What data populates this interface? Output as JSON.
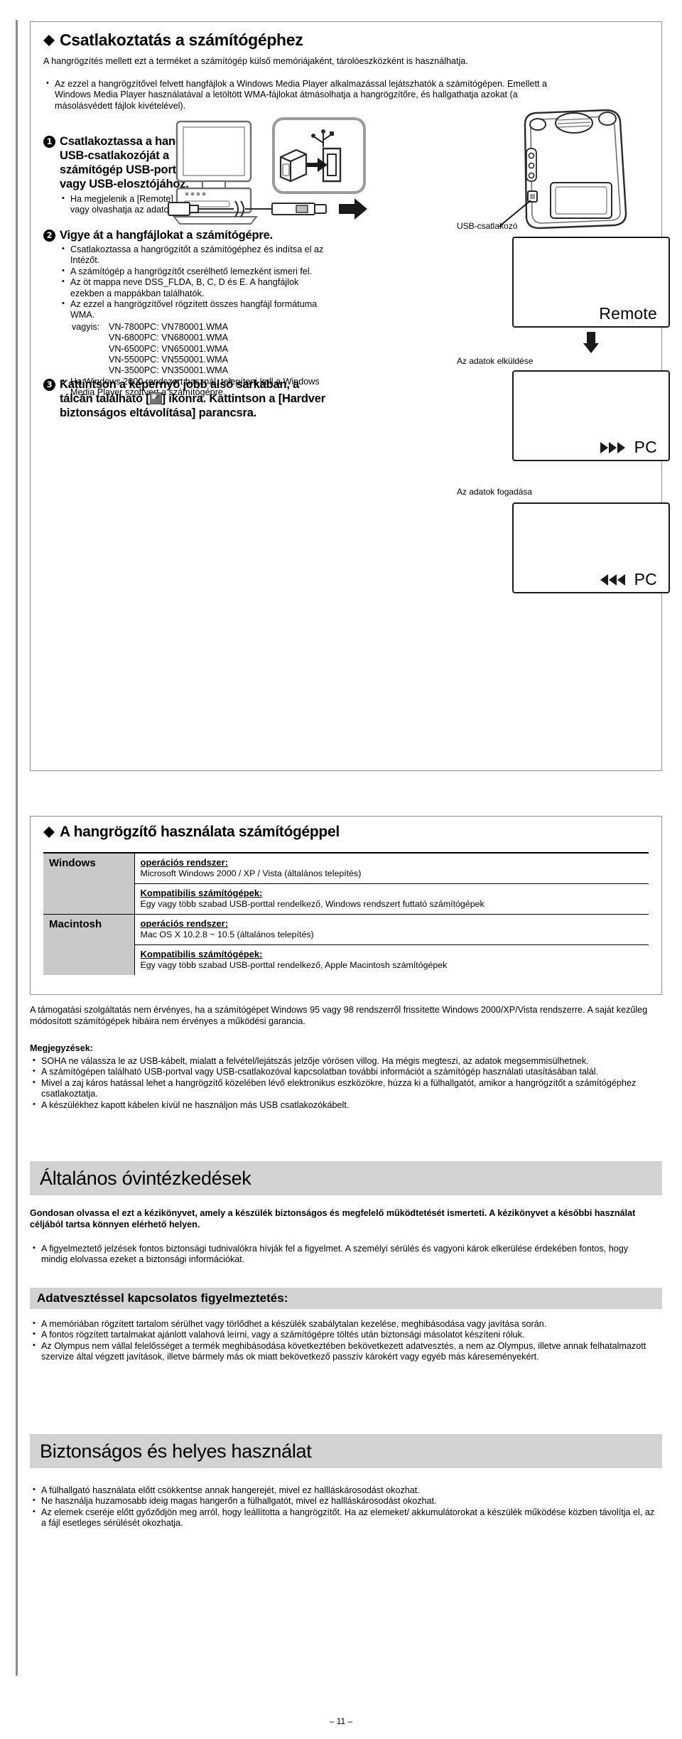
{
  "section1": {
    "title": "Csatlakoztatás a számítógéphez",
    "intro": "A hangrögzítés mellett ezt a terméket a számítógép külső memóriájaként, tárolóeszközként is használhatja.",
    "intro_bullets": [
      "Az ezzel a hangrögzítővel felvett hangfájlok a Windows Media Player alkalmazással lejátszhatók a számítógépen. Emellett a Windows Media Player használatával a letöltött WMA-fájlokat átmásolhatja a hangrögzítőre, és hallgathatja azokat (a másolásvédett fájlok kivételével)."
    ],
    "steps": [
      {
        "num": "1",
        "heading": "Csatlakoztassa a hangrögzítő USB-csatlakozóját a számítógép USB-portjához vagy USB-elosztójához.",
        "bullets": [
          "Ha megjelenik a [Remote] jel, mentheti vagy olvashatja az adatokat."
        ]
      },
      {
        "num": "2",
        "heading": "Vigye át a hangfájlokat a számítógépre.",
        "bullets": [
          "Csatlakoztassa a hangrögzítőt a számítógéphez és indítsa el az Intézőt.",
          "A számítógép a hangrögzítőt cserélhető lemezként ismeri fel.",
          "Az öt mappa neve DSS_FLDA, B, C, D és E. A hangfájlok ezekben a mappákban találhatók.",
          "Az ezzel a hangrögzítővel rögzített összes hangfájl formátuma WMA."
        ],
        "file_list_label": "vagyis:",
        "file_list": [
          "VN-7800PC: VN780001.WMA",
          "VN-6800PC: VN680001.WMA",
          "VN-6500PC: VN650001.WMA",
          "VN-5500PC: VN550001.WMA",
          "VN-3500PC: VN350001.WMA"
        ],
        "bullets_after": [
          "Ha Windows 2000 rendszert használ, telepíteni kell a Windows Media Player szoftvert a számítógépre."
        ]
      },
      {
        "num": "3",
        "heading_part1": "Kattintson a képernyő jobb alsó sarkában, a tálcán található [",
        "heading_icon": "tray-safely-remove-icon",
        "heading_part2": "] ikonra. Kattintson a [Hardver biztonságos eltávolítása] parancsra."
      }
    ],
    "diagram": {
      "usb_port_label": "USB-csatlakozó",
      "lcd_remote": "Remote",
      "caption_send": "Az adatok elküldése",
      "lcd_send": "PC",
      "lcd_send_icon": "fast-forward-icon",
      "caption_receive": "Az adatok fogadása",
      "lcd_receive": "PC",
      "lcd_receive_icon": "rewind-icon"
    }
  },
  "section2": {
    "title": "A hangrögzítő használata számítógéppel",
    "table": {
      "rows": [
        {
          "os": "Windows",
          "cells": [
            {
              "label": "operációs rendszer:",
              "value": "Microsoft Windows 2000 / XP / Vista (általános telepítés)"
            },
            {
              "label": "Kompatibilis számítógépek:",
              "value": "Egy vagy több szabad USB-porttal rendelkező, Windows rendszert futtató számítógépek"
            }
          ]
        },
        {
          "os": "Macintosh",
          "cells": [
            {
              "label": "operációs rendszer:",
              "value": "Mac OS X 10.2.8 ~ 10.5 (általános telepítés)"
            },
            {
              "label": "Kompatibilis számítógépek:",
              "value": "Egy vagy több szabad USB-porttal rendelkező, Apple Macintosh számítógépek"
            }
          ]
        }
      ]
    },
    "after_table": "A támogatási szolgáltatás nem érvényes, ha a számítógépet Windows 95 vagy 98 rendszerről frissítette Windows 2000/XP/Vista rendszerre. A saját kezűleg módosított számítógépek hibáira nem érvényes a működési garancia.",
    "notes_label": "Megjegyzések:",
    "notes": [
      "SOHA ne válassza le az USB-kábelt, mialatt a felvétel/lejátszás jelzője vörösen villog. Ha mégis megteszi, az adatok megsemmisülhetnek.",
      "A számítógépen található USB-portval vagy USB-csatlakozóval kapcsolatban további információt a számítógép használati utasításában talál.",
      "Mivel a zaj káros hatással lehet a hangrögzítő közelében lévő elektronikus eszközökre, húzza ki a fülhallgatót, amikor a hangrögzítőt a számítógéphez csatlakoztatja.",
      "A készülékhez kapott kábelen kívül ne használjon más USB csatlakozókábelt."
    ]
  },
  "section3": {
    "banner": "Általános óvintézkedések",
    "intro_bold": "Gondosan olvassa el ezt a kézikönyvet, amely a készülék biztonságos és megfelelő működtetését ismerteti. A kézikönyvet a későbbi használat céljából tartsa könnyen elérhető helyen.",
    "bullets": [
      "A figyelmeztető jelzések fontos biztonsági tudnivalókra hívják fel a figyelmet. A személyi sérülés és vagyoni károk elkerülése érdekében fontos, hogy mindig elolvassa ezeket a biztonsági információkat."
    ],
    "subbanner": "Adatvesztéssel kapcsolatos figyelmeztetés:",
    "sub_bullets": [
      "A memóriában rögzített tartalom sérülhet vagy törlődhet a készülék szabálytalan kezelése, meghibásodása vagy javítása során.",
      "A fontos rögzített tartalmakat ajánlott valahová leírni, vagy a számítógépre töltés után biztonsági másolatot készíteni róluk.",
      "Az Olympus nem vállal felelősséget a termék meghibásodása következtében bekövetkezett adatvesztés, a nem az Olympus, illetve annak felhatalmazott szervize által végzett javítások, illetve bármely más ok miatt bekövetkező passzív károkért vagy egyéb más káreseményekért."
    ]
  },
  "section4": {
    "banner": "Biztonságos és helyes használat",
    "bullets": [
      "A fülhallgató használata előtt csökkentse annak hangerejét, mivel ez hallláskárosodást okozhat.",
      "Ne használja huzamosabb ideig magas hangerőn a fülhallgatót, mivel ez hallláskárosodást okozhat.",
      "Az elemek cseréje előtt győződjön meg arról, hogy leállította a hangrögzítőt. Ha az elemeket/ akkumulátorokat a készülék működése közben távolítja el, az a fájl esetleges sérülését okozhatja."
    ]
  },
  "footer": {
    "page": "– 11 –"
  }
}
